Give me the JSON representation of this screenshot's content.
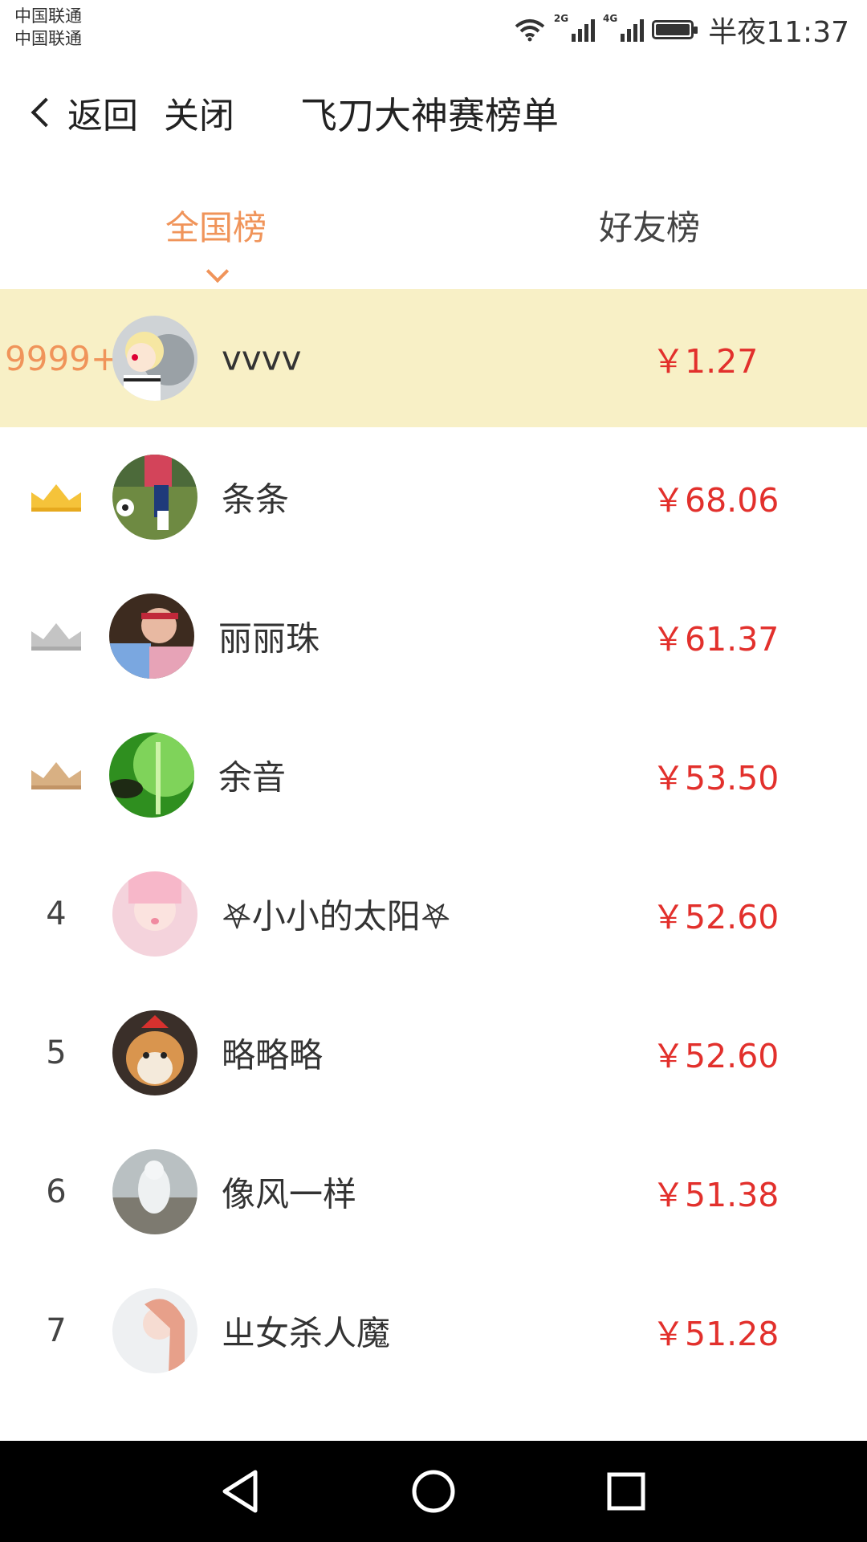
{
  "status": {
    "carriers": [
      "中国联通",
      "中国联通"
    ],
    "net1": "2G",
    "net2": "4G",
    "time": "半夜11:37"
  },
  "navbar": {
    "back_label": "返回",
    "close_label": "关闭",
    "title": "飞刀大神赛榜单"
  },
  "tabs": [
    {
      "label": "全国榜",
      "active": true
    },
    {
      "label": "好友榜",
      "active": false
    }
  ],
  "rows": [
    {
      "rank": "9999+",
      "name": "vvvv",
      "amount": "￥1.27",
      "highlight": true
    },
    {
      "rank": "crown-gold",
      "name": "条条",
      "amount": "￥68.06"
    },
    {
      "rank": "crown-silver",
      "name": "丽丽珠",
      "amount": "￥61.37"
    },
    {
      "rank": "crown-bronze",
      "name": "余音",
      "amount": "￥53.50"
    },
    {
      "rank": "4",
      "name": "𖤐小小的太阳𖤐",
      "amount": "￥52.60"
    },
    {
      "rank": "5",
      "name": "略略略",
      "amount": "￥52.60"
    },
    {
      "rank": "6",
      "name": "像风一样",
      "amount": "￥51.38"
    },
    {
      "rank": "7",
      "name": "ㄓ女杀人魔",
      "amount": "￥51.28"
    }
  ],
  "colors": {
    "accent": "#f0945a",
    "amount": "#e2302c",
    "highlight_bg": "#f8f0c6",
    "crown_gold": "#f5c33a",
    "crown_silver": "#c4c4c4",
    "crown_bronze": "#d8b083"
  }
}
